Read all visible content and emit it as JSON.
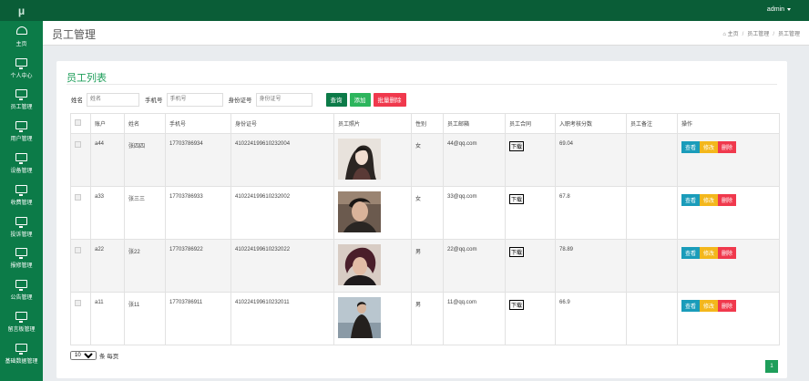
{
  "logo": "μ",
  "sidebar": {
    "items": [
      {
        "label": "主页",
        "icon": "dashboard-icon"
      },
      {
        "label": "个人中心",
        "icon": "monitor-icon"
      },
      {
        "label": "员工管理",
        "icon": "monitor-icon"
      },
      {
        "label": "用户管理",
        "icon": "monitor-icon"
      },
      {
        "label": "设备管理",
        "icon": "monitor-icon"
      },
      {
        "label": "收费管理",
        "icon": "monitor-icon"
      },
      {
        "label": "投诉管理",
        "icon": "monitor-icon"
      },
      {
        "label": "报修管理",
        "icon": "monitor-icon"
      },
      {
        "label": "公告管理",
        "icon": "monitor-icon"
      },
      {
        "label": "留言板管理",
        "icon": "monitor-icon"
      },
      {
        "label": "基础数据管理",
        "icon": "monitor-icon"
      }
    ]
  },
  "topbar": {
    "user": "admin"
  },
  "header": {
    "title": "员工管理",
    "breadcrumb": [
      "主页",
      "员工管理",
      "员工管理"
    ]
  },
  "card": {
    "title": "员工列表"
  },
  "filters": {
    "name_label": "姓名",
    "name_placeholder": "姓名",
    "phone_label": "手机号",
    "phone_placeholder": "手机号",
    "id_label": "身份证号",
    "id_placeholder": "身份证号",
    "search": "查询",
    "add": "添加",
    "batch_delete": "批量删除"
  },
  "table": {
    "headers": [
      "账户",
      "姓名",
      "手机号",
      "身份证号",
      "员工照片",
      "性别",
      "员工邮箱",
      "员工合同",
      "入职考核分数",
      "员工备注",
      "操作"
    ],
    "rows": [
      {
        "account": "a44",
        "name": "张四四",
        "phone": "17703786934",
        "idcard": "410224199610232004",
        "gender": "女",
        "email": "44@qq.com",
        "contract": "下载",
        "score": "69.04",
        "remark": ""
      },
      {
        "account": "a33",
        "name": "张三三",
        "phone": "17703786933",
        "idcard": "410224199610232002",
        "gender": "女",
        "email": "33@qq.com",
        "contract": "下载",
        "score": "67.8",
        "remark": ""
      },
      {
        "account": "a22",
        "name": "张22",
        "phone": "17703786922",
        "idcard": "410224199610232022",
        "gender": "男",
        "email": "22@qq.com",
        "contract": "下载",
        "score": "78.89",
        "remark": ""
      },
      {
        "account": "a11",
        "name": "张11",
        "phone": "17703786911",
        "idcard": "410224199610232011",
        "gender": "男",
        "email": "11@qq.com",
        "contract": "下载",
        "score": "66.9",
        "remark": ""
      }
    ],
    "actions": {
      "view": "查看",
      "edit": "修改",
      "delete": "删除"
    }
  },
  "pagination": {
    "page_size": "10",
    "per_page_label": "条 每页",
    "current_page": "1"
  },
  "colors": {
    "primary": "#0c7b48",
    "dark": "#0a5d37",
    "accent": "#1e9e5a",
    "danger": "#f0394d",
    "warning": "#f3b71c",
    "info": "#1a9cba"
  }
}
